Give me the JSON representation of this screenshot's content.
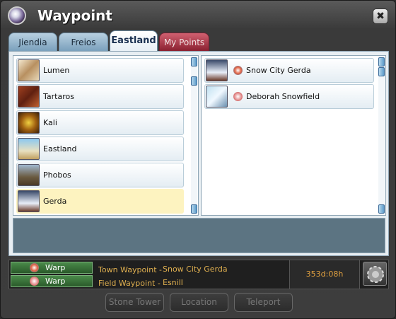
{
  "window": {
    "title": "Waypoint",
    "close_label": "✖"
  },
  "tabs": [
    {
      "label": "Jiendia"
    },
    {
      "label": "Freios"
    },
    {
      "label": "Eastland"
    },
    {
      "label": "My Points"
    }
  ],
  "regions": [
    {
      "label": "Lumen"
    },
    {
      "label": "Tartaros"
    },
    {
      "label": "Kali"
    },
    {
      "label": "Eastland"
    },
    {
      "label": "Phobos"
    },
    {
      "label": "Gerda"
    }
  ],
  "waypoints": [
    {
      "label": "Snow City Gerda"
    },
    {
      "label": "Deborah Snowfield"
    }
  ],
  "bottom": {
    "warp1": "Warp",
    "warp2": "Warp",
    "town_label": "Town Waypoint -",
    "town_value": "Snow City Gerda",
    "field_label": "Field Waypoint -",
    "field_value": "Esnill",
    "timer": "353d:08h"
  },
  "buttons": {
    "stone_tower": "Stone Tower",
    "location": "Location",
    "teleport": "Teleport"
  },
  "colors": {
    "accent_gold": "#e0b050",
    "selected_row": "#fdf3c0",
    "warp_green": "#3a7a3a"
  }
}
